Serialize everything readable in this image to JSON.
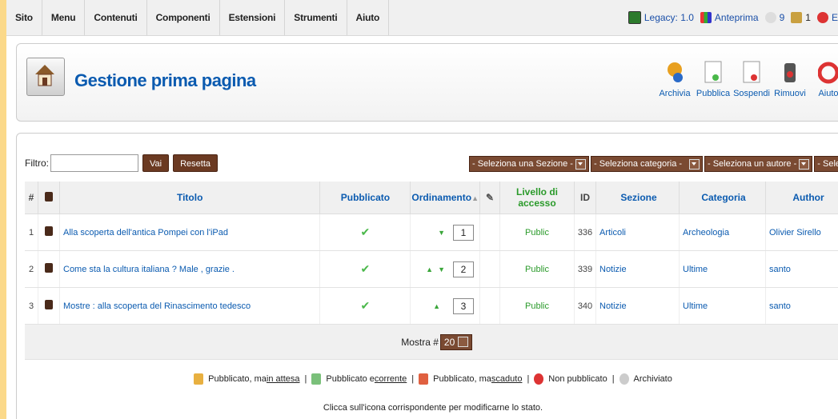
{
  "menubar": {
    "items": [
      "Sito",
      "Menu",
      "Contenuti",
      "Componenti",
      "Estensioni",
      "Strumenti",
      "Aiuto"
    ]
  },
  "status": {
    "legacy": "Legacy: 1.0",
    "preview": "Anteprima",
    "messages": "9",
    "users": "1",
    "logout": "E"
  },
  "header": {
    "title": "Gestione prima pagina",
    "toolbar": [
      "Archivia",
      "Pubblica",
      "Sospendi",
      "Rimuovi",
      "Aiuto"
    ]
  },
  "filter": {
    "label": "Filtro:",
    "value": "",
    "go_label": "Vai",
    "reset_label": "Resetta",
    "selects": [
      "- Seleziona una Sezione -",
      "- Seleziona categoria -",
      "- Seleziona un autore -",
      "- Seleziona stato -"
    ]
  },
  "table": {
    "headers": {
      "num": "#",
      "title": "Titolo",
      "published": "Pubblicato",
      "ordering": "Ordinamento",
      "access": "Livello di accesso",
      "id": "ID",
      "section": "Sezione",
      "category": "Categoria",
      "author": "Author"
    },
    "rows": [
      {
        "num": "1",
        "title": "Alla scoperta dell'antica Pompei con l'iPad",
        "order": "1",
        "access": "Public",
        "id": "336",
        "section": "Articoli",
        "category": "Archeologia",
        "author": "Olivier Sirello",
        "up": "",
        "down": "▼"
      },
      {
        "num": "2",
        "title": "Come sta la cultura italiana ? Male , grazie .",
        "order": "2",
        "access": "Public",
        "id": "339",
        "section": "Notizie",
        "category": "Ultime",
        "author": "santo",
        "up": "▲",
        "down": "▼"
      },
      {
        "num": "3",
        "title": "Mostre : alla scoperta del Rinascimento tedesco",
        "order": "3",
        "access": "Public",
        "id": "340",
        "section": "Notizie",
        "category": "Ultime",
        "author": "santo",
        "up": "▲",
        "down": ""
      }
    ],
    "display_label": "Mostra #",
    "display_value": "20"
  },
  "legend": {
    "pending_pre": "Pubblicato, ma ",
    "pending_u": "in attesa",
    "current_pre": "Pubblicato e ",
    "current_u": "corrente",
    "expired_pre": "Pubblicato, ma ",
    "expired_u": "scaduto",
    "unpublished": "Non pubblicato",
    "archived": "Archiviato",
    "sep": "|",
    "hint": "Clicca sull'icona corrispondente per modificarne lo stato."
  },
  "colors": {
    "link": "#0b5bb0",
    "accent_button": "#6b3a22",
    "public": "#2a9a2a",
    "page_bg": "#fbd98a"
  }
}
